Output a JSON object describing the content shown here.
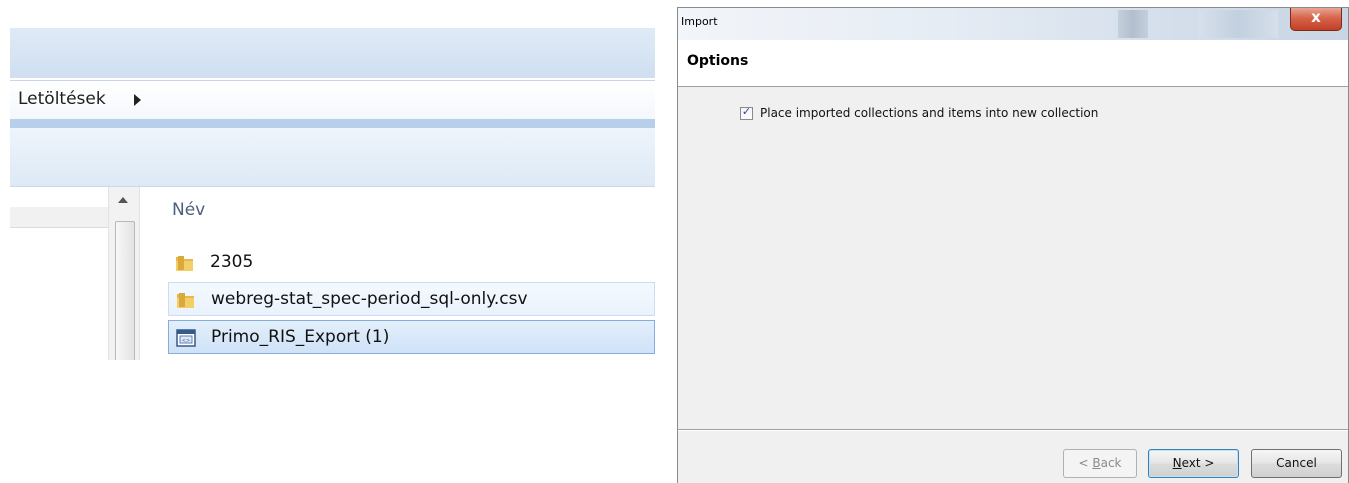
{
  "explorer": {
    "breadcrumb": "Letöltések",
    "column_header": "Név",
    "files": [
      {
        "name": "2305",
        "icon": "folder-icon"
      },
      {
        "name": "webreg-stat_spec-period_sql-only.csv",
        "icon": "folder-icon"
      },
      {
        "name": "Primo_RIS_Export (1)",
        "icon": "ris-file-icon"
      }
    ]
  },
  "dialog": {
    "title": "Import",
    "close_label": "x",
    "header": "Options",
    "option_label": "Place imported collections and items into new collection",
    "option_checked": true,
    "buttons": {
      "back": "< Back",
      "next": "Next >",
      "cancel": "Cancel"
    }
  },
  "colors": {
    "accent": "#3c7fb1",
    "selection": "#cfe2f8",
    "close": "#c23f26"
  }
}
